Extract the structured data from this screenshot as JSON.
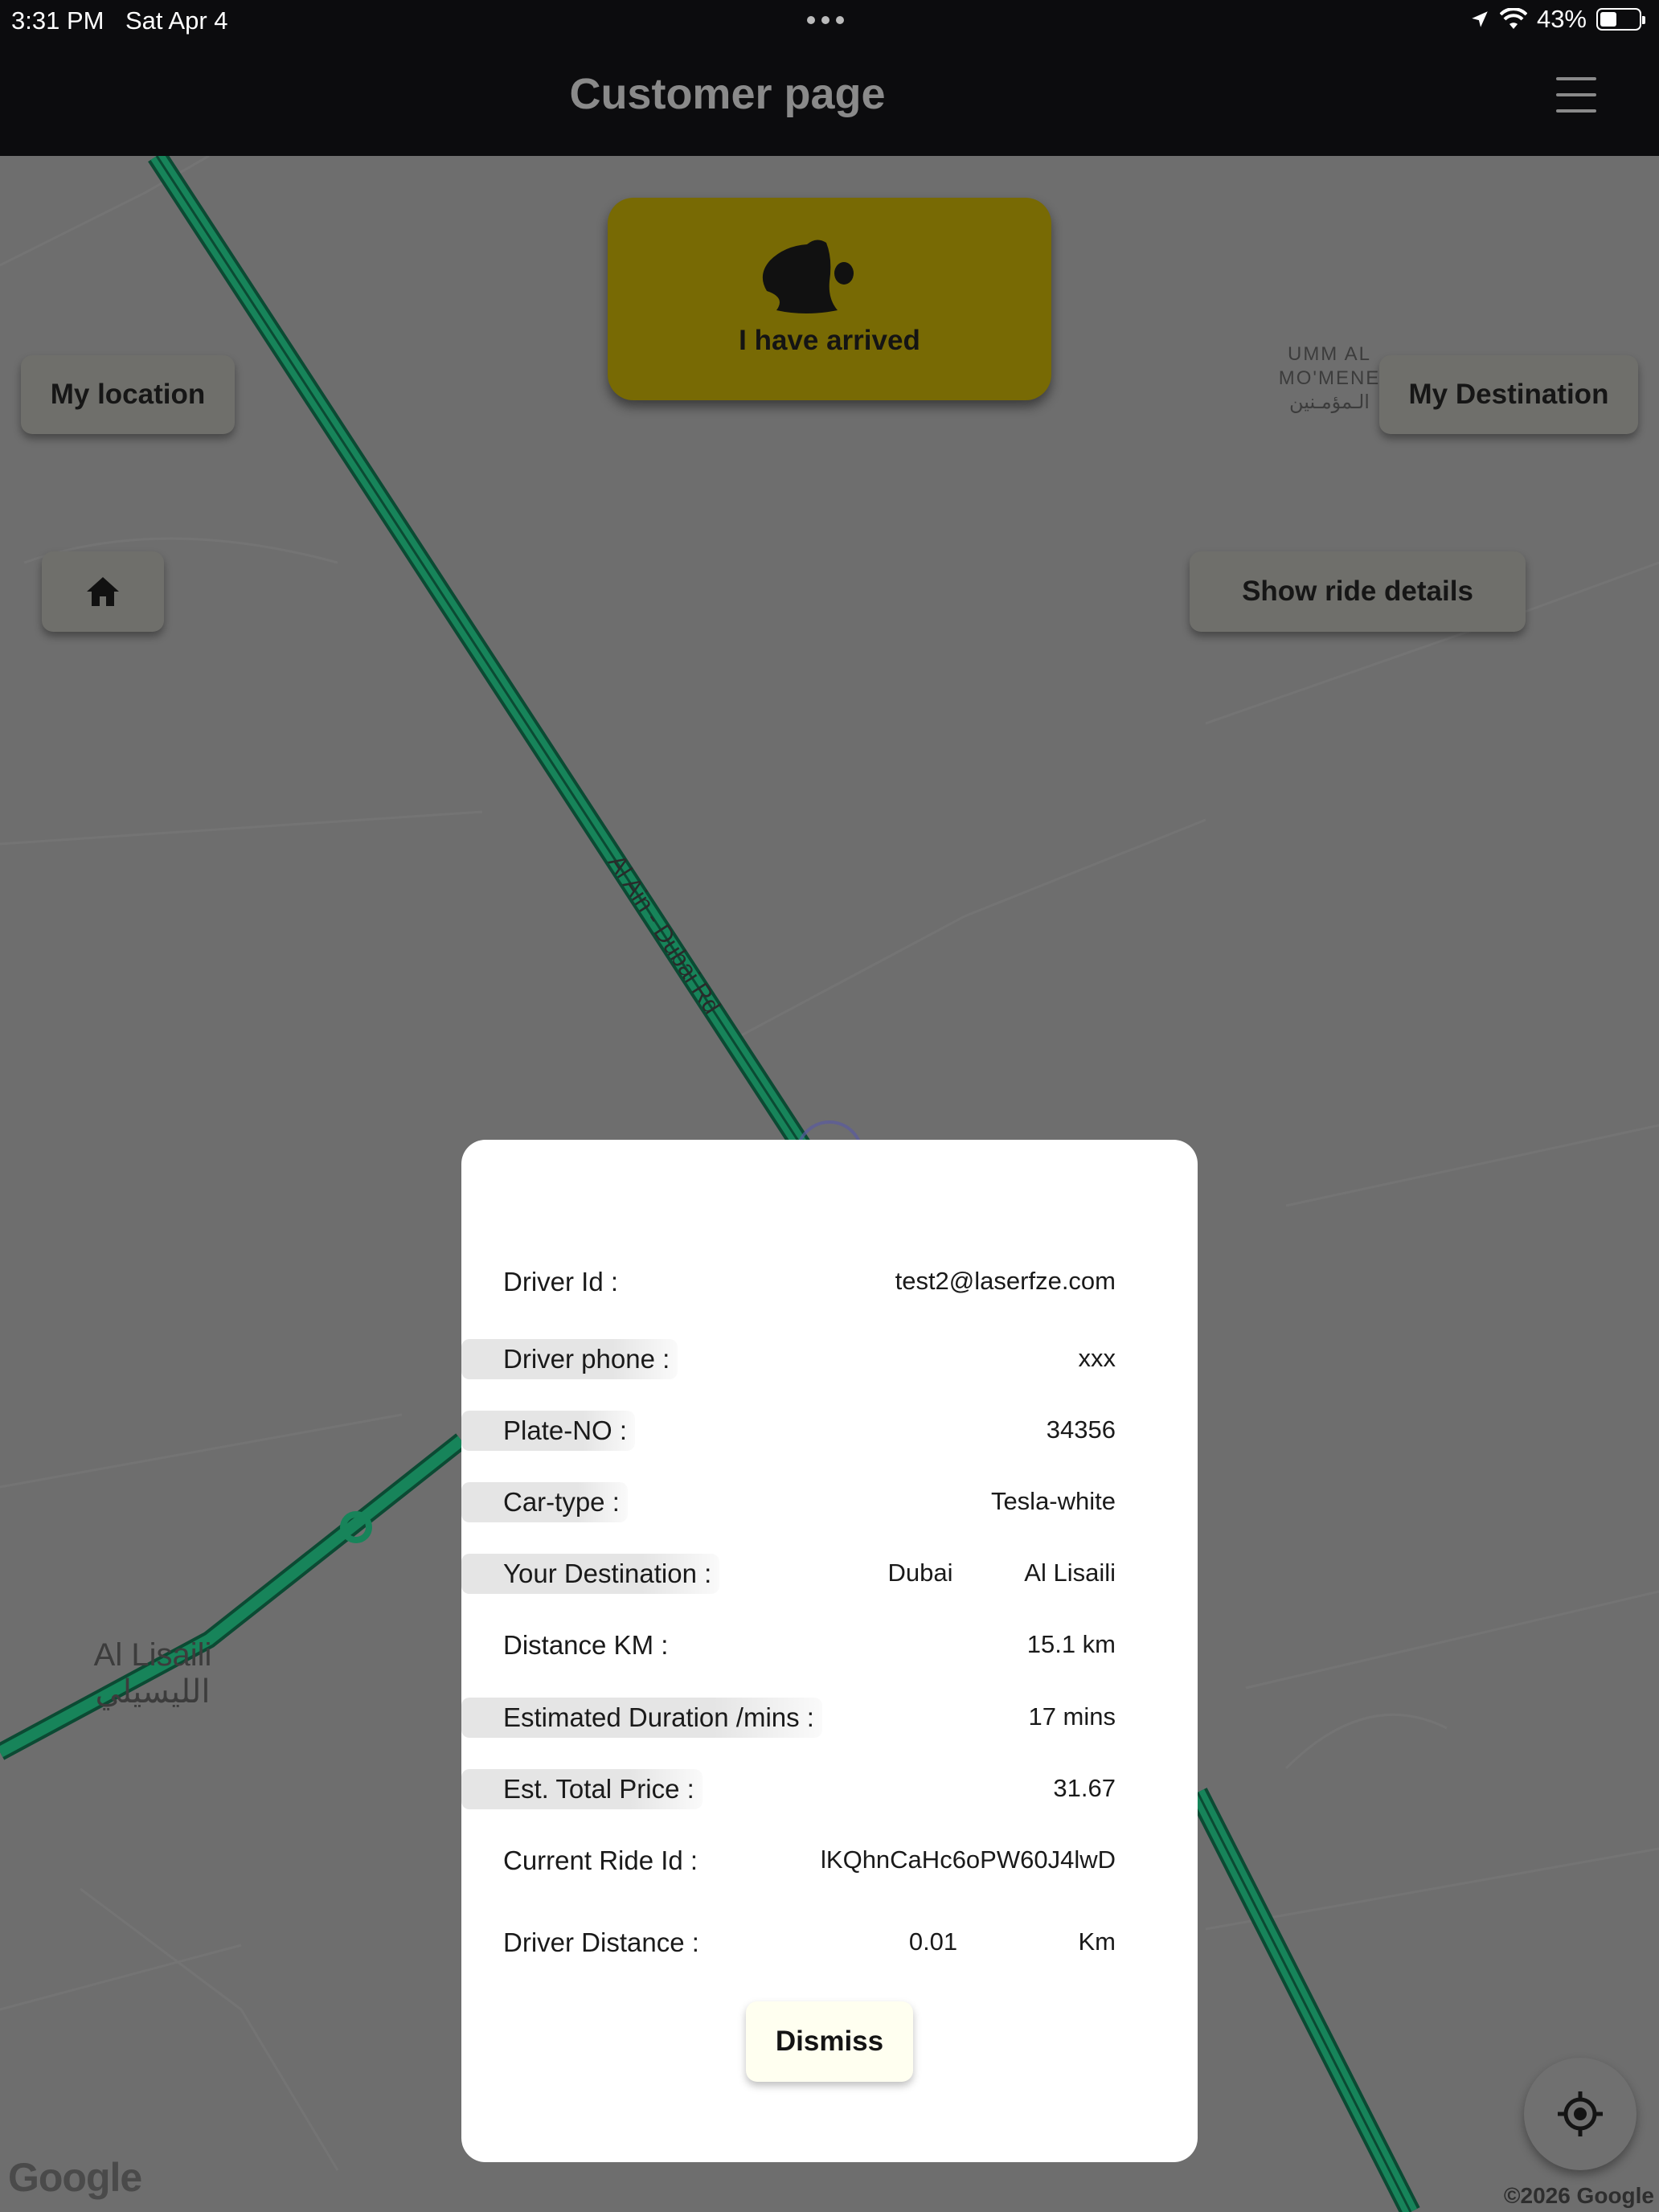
{
  "status_bar": {
    "time": "3:31 PM",
    "date": "Sat Apr 4",
    "battery": "43%",
    "battery_level": 0.43
  },
  "header": {
    "title": "Customer page",
    "menu_icon": "hamburger-menu-icon"
  },
  "map": {
    "road_label": "Al Ain - Dubai Rd",
    "place_label_en": "Al Lisaili",
    "place_label_ar": "الليسيلي",
    "area_label_lines": [
      "UMM AL",
      "MO'MENE",
      "الـمؤمـنين"
    ],
    "attribution": "Google",
    "copyright": "©2026 Google",
    "road_color": "#0f6e4a"
  },
  "buttons": {
    "arrived_label": "I have arrived",
    "arrived_icon": "bell-icon",
    "arrived_color": "#786a04",
    "my_location": "My location",
    "my_destination": "My Destination",
    "home_icon": "home-icon",
    "show_ride_details": "Show ride details",
    "locate_icon": "crosshair-icon"
  },
  "dialog": {
    "rows": [
      {
        "label": "Driver Id :",
        "value": "test2@laserfze.com"
      },
      {
        "label": "Driver phone :",
        "value": "xxx"
      },
      {
        "label": "Plate-NO :",
        "value": "34356"
      },
      {
        "label": "Car-type :",
        "value": "Tesla-white"
      },
      {
        "label": "Your Destination :",
        "value_mid": "Dubai",
        "value": "Al Lisaili"
      },
      {
        "label": "Distance KM :",
        "value": "15.1 km"
      },
      {
        "label": "Estimated Duration /mins :",
        "value": "17 mins"
      },
      {
        "label": "Est. Total Price :",
        "value": "31.67"
      },
      {
        "label": "Current Ride Id :",
        "value": "lKQhnCaHc6oPW60J4lwD"
      },
      {
        "label": "Driver Distance :",
        "value_mid": "0.01",
        "value": "Km"
      }
    ],
    "dismiss_label": "Dismiss"
  }
}
